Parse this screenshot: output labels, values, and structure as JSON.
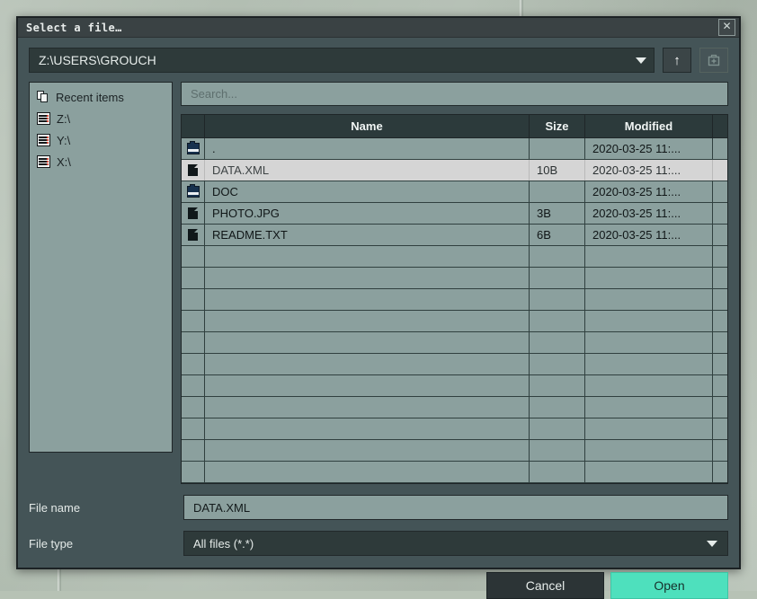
{
  "window": {
    "title": "Select a file…",
    "close_label": "✕"
  },
  "pathbar": {
    "path": "Z:\\USERS\\GROUCH",
    "dropdown_icon": "chevron-down-icon",
    "up_label": "↑",
    "new_folder_icon": "new-folder-icon"
  },
  "sidebar": {
    "items": [
      {
        "label": "Recent items",
        "icon": "recent-items-icon"
      },
      {
        "label": "Z:\\",
        "icon": "drive-icon"
      },
      {
        "label": "Y:\\",
        "icon": "drive-icon"
      },
      {
        "label": "X:\\",
        "icon": "drive-icon"
      }
    ]
  },
  "search": {
    "placeholder": "Search..."
  },
  "table": {
    "columns": [
      "Name",
      "Size",
      "Modified"
    ],
    "rows": [
      {
        "name": ".",
        "size": "",
        "modified": "2020-03-25 11:...",
        "icon": "folder-icon",
        "selected": false
      },
      {
        "name": "DATA.XML",
        "size": "10B",
        "modified": "2020-03-25 11:...",
        "icon": "file-icon",
        "selected": true
      },
      {
        "name": "DOC",
        "size": "",
        "modified": "2020-03-25 11:...",
        "icon": "folder-icon",
        "selected": false
      },
      {
        "name": "PHOTO.JPG",
        "size": "3B",
        "modified": "2020-03-25 11:...",
        "icon": "file-icon",
        "selected": false
      },
      {
        "name": "README.TXT",
        "size": "6B",
        "modified": "2020-03-25 11:...",
        "icon": "file-icon",
        "selected": false
      }
    ],
    "empty_row_count": 11
  },
  "form": {
    "filename_label": "File name",
    "filename_value": "DATA.XML",
    "filetype_label": "File type",
    "filetype_value": "All files (*.*)",
    "filetype_arrow": "chevron-down-icon"
  },
  "actions": {
    "cancel_label": "Cancel",
    "open_label": "Open"
  },
  "colors": {
    "accent": "#4ee0bd",
    "dialog_bg": "#445457",
    "titlebar": "#3a4244",
    "list_bg": "#8ba09e",
    "selection": "#d5d5d5",
    "desktop": "#b9c4b8"
  }
}
